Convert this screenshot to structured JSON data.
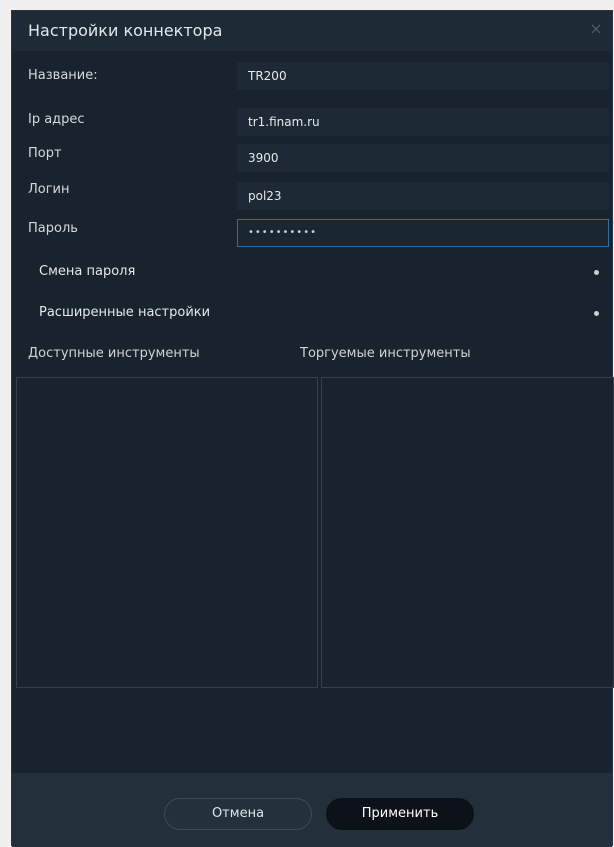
{
  "window": {
    "title": "Настройки коннектора",
    "close_glyph": "×"
  },
  "form": {
    "name_label": "Название:",
    "name_value": "TR200",
    "ip_label": "Ip адрес",
    "ip_value": "tr1.finam.ru",
    "port_label": "Порт",
    "port_value": "3900",
    "login_label": "Логин",
    "login_value": "pol23",
    "password_label": "Пароль",
    "password_value": "••••••••••"
  },
  "sections": {
    "change_password": "Смена пароля",
    "advanced_settings": "Расширенные настройки"
  },
  "instruments": {
    "available_label": "Доступные инструменты",
    "traded_label": "Торгуемые инструменты"
  },
  "footer": {
    "cancel_label": "Отмена",
    "apply_label": "Применить"
  },
  "colors": {
    "background": "#18232e",
    "titlebar": "#1e2b37",
    "field": "#1d2934",
    "active_border": "#2b6fa3",
    "footer": "#232f3b",
    "apply_button": "#0c1218"
  },
  "icons": {
    "close": "close-icon",
    "section_toggle": "dot-icon"
  }
}
